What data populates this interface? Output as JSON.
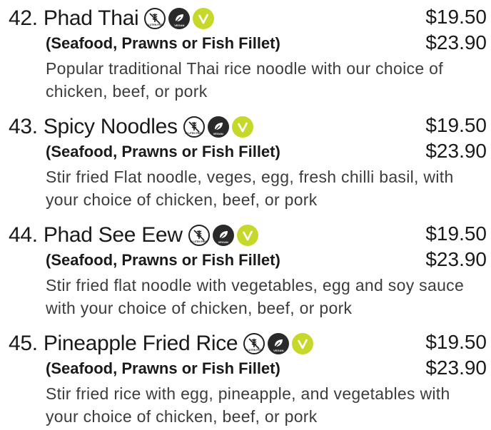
{
  "menu": {
    "items": [
      {
        "number": "42.",
        "name": "Phad Thai",
        "price_regular": "$19.50",
        "sub_label": "(Seafood, Prawns or Fish Fillet)",
        "price_seafood": "$23.90",
        "description": "Popular traditional Thai rice noodle with our choice of chicken, beef, or pork",
        "badges": [
          "gluten-free-icon",
          "vegan-icon",
          "vegetarian-icon"
        ]
      },
      {
        "number": "43.",
        "name": "Spicy Noodles",
        "price_regular": "$19.50",
        "sub_label": "(Seafood, Prawns or Fish Fillet)",
        "price_seafood": "$23.90",
        "description": "Stir fried Flat noodle, veges, egg, fresh chilli basil, with your choice of chicken, beef, or pork",
        "badges": [
          "gluten-free-icon",
          "vegan-icon",
          "vegetarian-icon"
        ]
      },
      {
        "number": "44.",
        "name": "Phad See Eew",
        "price_regular": "$19.50",
        "sub_label": "(Seafood, Prawns or Fish Fillet)",
        "price_seafood": "$23.90",
        "description": "Stir fried flat noodle with vegetables, egg and soy sauce with your choice of chicken, beef, or pork",
        "badges": [
          "gluten-free-icon",
          "vegan-icon",
          "vegetarian-icon"
        ]
      },
      {
        "number": "45.",
        "name": "Pineapple Fried Rice",
        "price_regular": "$19.50",
        "sub_label": "(Seafood, Prawns or Fish Fillet)",
        "price_seafood": "$23.90",
        "description": "Stir fried rice with egg, pineapple, and vegetables with your choice of chicken, beef, or pork",
        "badges": [
          "gluten-free-icon",
          "vegan-icon",
          "vegetarian-icon"
        ]
      }
    ],
    "badge_text": {
      "gluten_free": "GLUTEN FREE",
      "vegan": "VEGAN"
    },
    "colors": {
      "text": "#1a1a1a",
      "description": "#3c3c3c",
      "vegetarian_badge": "#c6d82a",
      "vegan_badge": "#2a2a2a"
    }
  }
}
